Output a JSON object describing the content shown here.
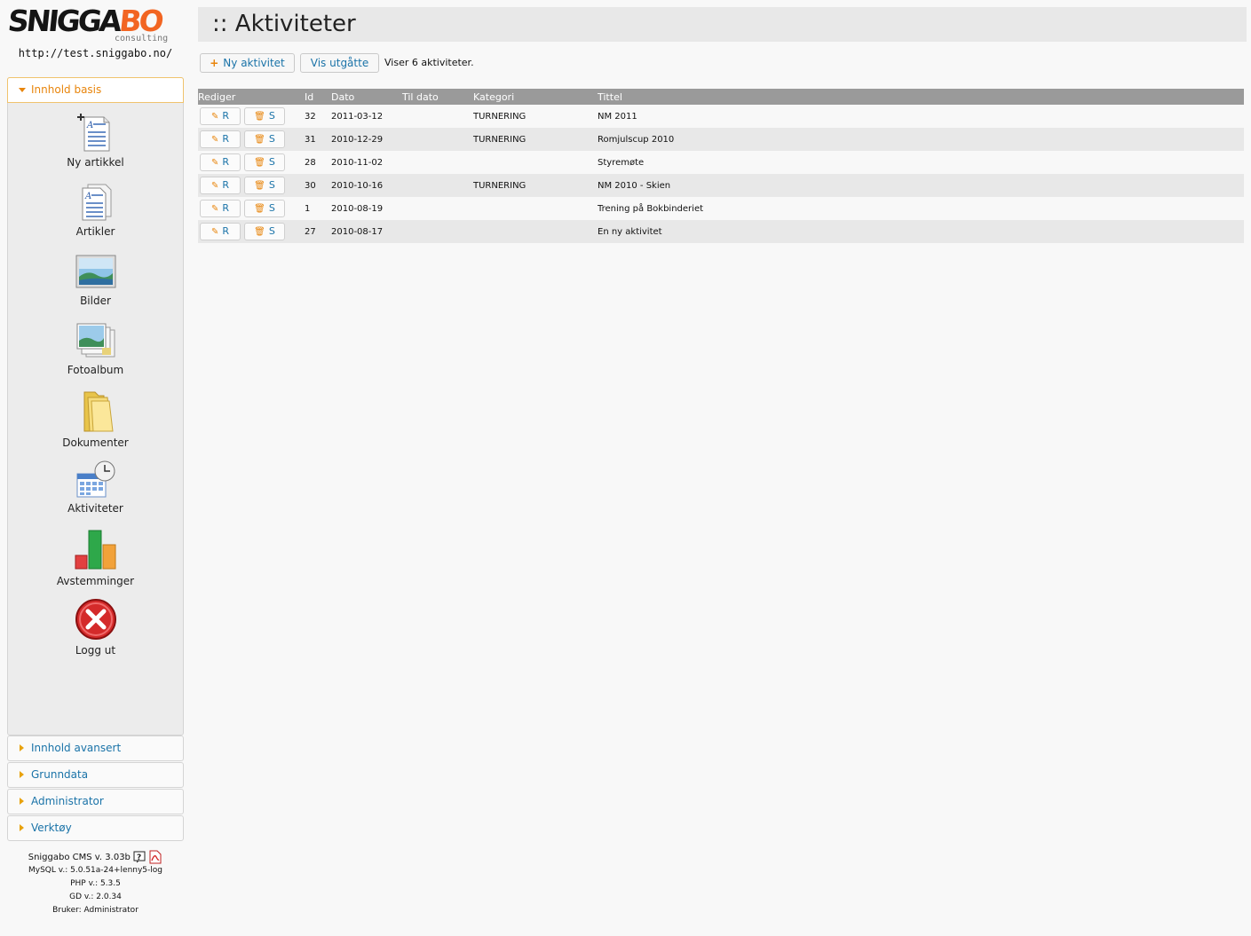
{
  "logo": {
    "main_dark": "SNIGGA",
    "main_orange": "BO",
    "sub": "consulting"
  },
  "site_url": "http://test.sniggabo.no/",
  "sidebar": {
    "open_section": "Innhold basis",
    "items": [
      {
        "label": "Ny artikkel",
        "icon": "new-article-icon"
      },
      {
        "label": "Artikler",
        "icon": "articles-icon"
      },
      {
        "label": "Bilder",
        "icon": "images-icon"
      },
      {
        "label": "Fotoalbum",
        "icon": "photo-album-icon"
      },
      {
        "label": "Dokumenter",
        "icon": "folder-icon"
      },
      {
        "label": "Aktiviteter",
        "icon": "calendar-clock-icon"
      },
      {
        "label": "Avstemminger",
        "icon": "bar-chart-icon"
      },
      {
        "label": "Logg ut",
        "icon": "logout-icon"
      }
    ],
    "closed_sections": [
      "Innhold avansert",
      "Grunndata",
      "Administrator",
      "Verktøy"
    ]
  },
  "footer": {
    "cms_version": "Sniggabo CMS v. 3.03b",
    "mysql": "MySQL v.: 5.0.51a-24+lenny5-log",
    "php": "PHP v.: 5.3.5",
    "gd": "GD v.: 2.0.34",
    "user": "Bruker: Administrator"
  },
  "page": {
    "title": ":: Aktiviteter"
  },
  "toolbar": {
    "new_label": "Ny aktivitet",
    "expired_label": "Vis utgåtte",
    "info": "Viser 6 aktiviteter."
  },
  "table": {
    "headers": {
      "edit": "Rediger",
      "id": "Id",
      "date": "Dato",
      "to_date": "Til dato",
      "category": "Kategori",
      "title": "Tittel"
    },
    "edit_label": "R",
    "delete_label": "S",
    "rows": [
      {
        "id": "32",
        "date": "2011-03-12",
        "to_date": "",
        "category": "TURNERING",
        "title": "NM 2011"
      },
      {
        "id": "31",
        "date": "2010-12-29",
        "to_date": "",
        "category": "TURNERING",
        "title": "Romjulscup 2010"
      },
      {
        "id": "28",
        "date": "2010-11-02",
        "to_date": "",
        "category": "",
        "title": "Styremøte"
      },
      {
        "id": "30",
        "date": "2010-10-16",
        "to_date": "",
        "category": "TURNERING",
        "title": "NM 2010 - Skien"
      },
      {
        "id": "1",
        "date": "2010-08-19",
        "to_date": "",
        "category": "",
        "title": "Trening på Bokbinderiet"
      },
      {
        "id": "27",
        "date": "2010-08-17",
        "to_date": "",
        "category": "",
        "title": "En ny aktivitet"
      }
    ]
  },
  "colors": {
    "accent_orange": "#e8850c",
    "link_blue": "#1a73a8",
    "header_gray": "#9a9a9a"
  }
}
